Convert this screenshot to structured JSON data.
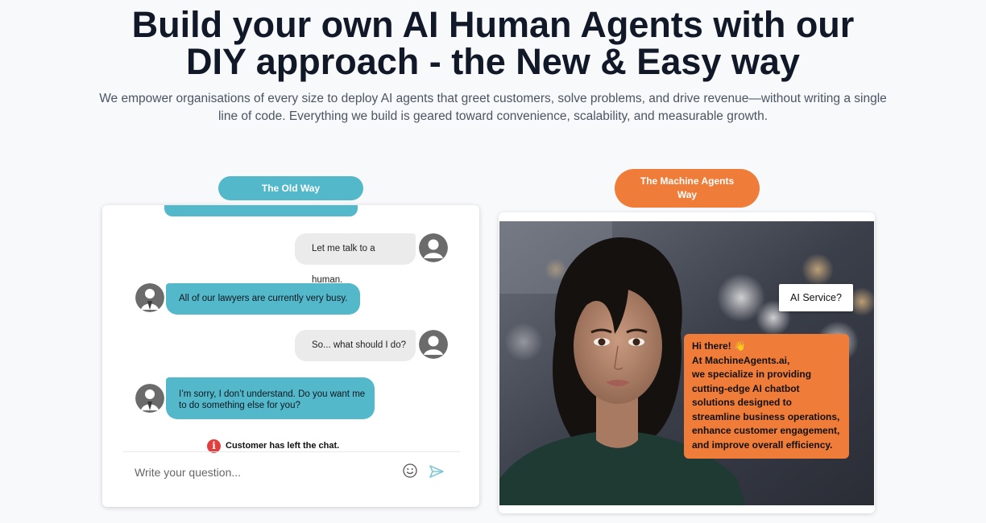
{
  "hero": {
    "title_line1": "Build your own AI Human Agents with our",
    "title_line2": "DIY approach - the New & Easy way",
    "subtitle": "We empower organisations of every size to deploy AI agents that greet customers, solve problems, and drive revenue—without writing a single line of code. Everything we build is geared toward convenience, scalability, and measurable growth."
  },
  "old_way": {
    "label": "The Old Way",
    "messages": [
      {
        "from": "user",
        "text": "Let me talk to a human."
      },
      {
        "from": "bot",
        "text": "All of our lawyers are currently very busy."
      },
      {
        "from": "user",
        "text": "So... what should I do?"
      },
      {
        "from": "bot",
        "text": "I’m sorry, I don’t understand. Do you want me to do something else for you?"
      }
    ],
    "notice_icon": "i",
    "notice": "Customer has left the chat.",
    "input_placeholder": "Write your question...",
    "icons": {
      "emoji": "smiley-icon",
      "send": "send-icon",
      "user": "user-avatar-icon",
      "agent": "agent-avatar-icon"
    }
  },
  "new_way": {
    "label_line1": "The Machine Agents",
    "label_line2": "Way",
    "user_message": "AI Service?",
    "agent_reply": "Hi there! 👋\nAt MachineAgents.ai,\nwe specialize in providing cutting-edge AI chatbot solutions designed to streamline business operations, enhance customer engagement, and improve overall efficiency."
  },
  "colors": {
    "teal": "#53b8c9",
    "orange": "#ef7c38",
    "title": "#111827",
    "subtitle": "#4b5563"
  }
}
